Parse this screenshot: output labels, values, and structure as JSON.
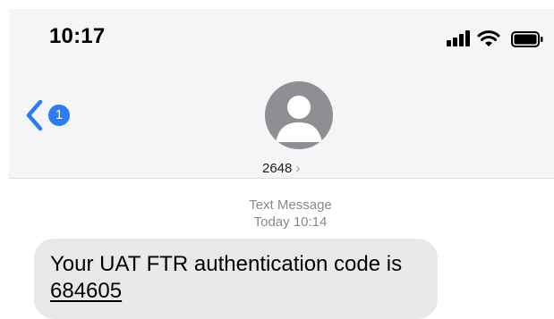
{
  "status_bar": {
    "time": "10:17",
    "icons": [
      "cellular-signal-icon",
      "wifi-icon",
      "battery-icon"
    ]
  },
  "nav": {
    "back_icon": "chevron-left-icon",
    "back_badge": "1",
    "contact_name": "2648",
    "contact_chevron": "›",
    "avatar_icon": "person-silhouette-icon"
  },
  "conversation": {
    "message_type": "Text Message",
    "timestamp": "Today 10:14",
    "messages": [
      {
        "text": "Your UAT FTR authentication code is",
        "code": "684605",
        "direction": "incoming"
      }
    ]
  },
  "colors": {
    "accent": "#2a7bf6",
    "header_bg": "#f5f5f7",
    "bubble_bg": "#e9e9eb",
    "meta_text": "#8a8a8e",
    "avatar_bg": "#8e8e93"
  }
}
